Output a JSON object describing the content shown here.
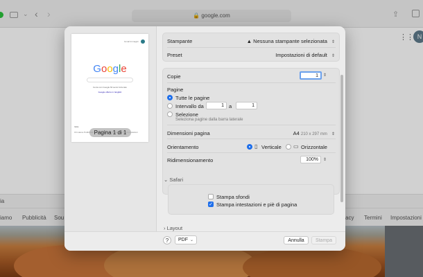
{
  "browser": {
    "url": "google.com",
    "avatar_letter": "N"
  },
  "background_page": {
    "footer_country": "ia",
    "footer_links": [
      "iamo",
      "Pubblicità",
      "Sou",
      "acy",
      "Termini",
      "Impostazioni"
    ]
  },
  "preview": {
    "page_label": "Pagina 1 di 1",
    "logo_text": "Google",
    "buttons_text": "Cerca con Google   Mi sento fortunato",
    "language_text": "Google offerto in: English",
    "footer_country": "Italia",
    "footer_links": "Chi siamo  Pubblicità  Soluzioni aziendali     Privacy  Termini  Impostazioni",
    "top_links": "Gmail  Immagini"
  },
  "print": {
    "printer_label": "Stampante",
    "printer_value": "Nessuna stampante selezionata",
    "preset_label": "Preset",
    "preset_value": "Impostazioni di default",
    "copies_label": "Copie",
    "copies_value": "1",
    "pages_label": "Pagine",
    "pages_all": "Tutte le pagine",
    "pages_range": "Intervallo da",
    "range_from": "1",
    "range_to_label": "a",
    "range_to": "1",
    "pages_selection": "Selezione",
    "selection_hint": "Seleziona pagine dalla barra laterale",
    "paper_label": "Dimensioni pagina",
    "paper_value": "A4",
    "paper_dims": "210 x 297 mm",
    "orientation_label": "Orientamento",
    "orientation_portrait": "Verticale",
    "orientation_landscape": "Orizzontale",
    "scaling_label": "Ridimensionamento",
    "scaling_value": "100%",
    "safari_label": "Safari",
    "print_backgrounds": "Stampa sfondi",
    "print_headers": "Stampa intestazioni e piè di pagina",
    "layout_label": "Layout",
    "help_label": "?",
    "pdf_label": "PDF",
    "cancel_label": "Annulla",
    "print_label": "Stampa"
  },
  "state": {
    "pages_mode": "all",
    "orientation": "portrait",
    "print_backgrounds": false,
    "print_headers": true
  }
}
